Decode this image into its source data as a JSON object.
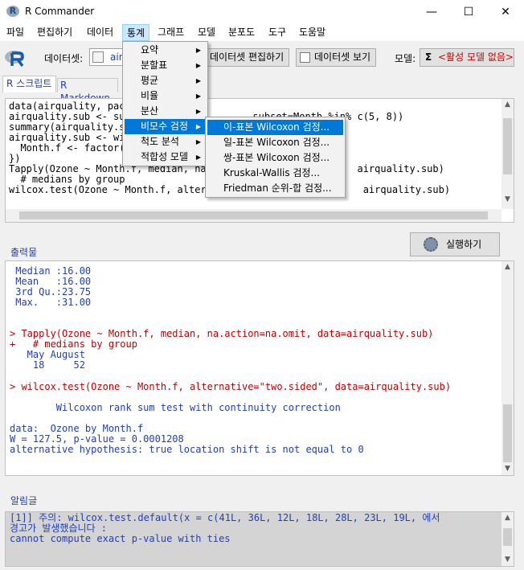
{
  "window": {
    "title": "R Commander",
    "minimize": "—",
    "maximize": "☐",
    "close": "✕"
  },
  "menubar": [
    "파일",
    "편집하기",
    "데이터",
    "통계",
    "그래프",
    "모델",
    "분포도",
    "도구",
    "도움말"
  ],
  "toolbar": {
    "dataset_label": "데이터셋:",
    "dataset_value": "air",
    "edit_dataset": "데이터셋 편집하기",
    "view_dataset": "데이터셋 보기",
    "model_label": "모델:",
    "model_sigma": "Σ",
    "model_value": "<활성 모델 없음>"
  },
  "tabs": {
    "script": "R 스크립트",
    "markdown": "R Markdown"
  },
  "script": {
    "text": "data(airquality, pac\nairquality.sub <- su                      subset=Month %in% c(5, 8))\nsummary(airquality.s\nairquality.sub <- wi\n  Month.f <- factor(\n})\nTapply(Ozone ~ Month.f, median, na.                         airquality.sub)\n  # medians by group\nwilcox.test(Ozone ~ Month.f, altern                          airquality.sub)"
  },
  "output": {
    "label": "출력물",
    "run_button": "실행하기",
    "block1": " Median :16.00\n Mean   :16.00\n 3rd Qu.:23.75\n Max.   :31.00",
    "cmd1": "> Tapply(Ozone ~ Month.f, median, na.action=na.omit, data=airquality.sub)\n+   # medians by group",
    "result1": "   May August\n    18     52",
    "cmd2": "> wilcox.test(Ozone ~ Month.f, alternative=\"two.sided\", data=airquality.sub)",
    "title": "        Wilcoxon rank sum test with continuity correction",
    "result2": "data:  Ozone by Month.f\nW = 127.5, p-value = 0.0001208\nalternative hypothesis: true location shift is not equal to 0"
  },
  "messages": {
    "label": "알림글",
    "text": "[1]] 주의: wilcox.test.default(x = c(41L, 36L, 12L, 18L, 28L, 23L, 19L, 에서\n경고가 발생했습니다 :\ncannot compute exact p-value with ties"
  },
  "stats_menu": [
    {
      "label": "요약",
      "submenu": true
    },
    {
      "label": "분할표",
      "submenu": true
    },
    {
      "label": "평균",
      "submenu": true
    },
    {
      "label": "비율",
      "submenu": true
    },
    {
      "label": "분산",
      "submenu": true
    },
    {
      "label": "비모수 검정",
      "submenu": true,
      "highlighted": true
    },
    {
      "label": "척도 분석",
      "submenu": true
    },
    {
      "label": "적합성 모델",
      "submenu": true
    }
  ],
  "nonparam_menu": [
    {
      "label": "이-표본 Wilcoxon 검정...",
      "highlighted": true
    },
    {
      "label": "일-표본 Wilcoxon 검정..."
    },
    {
      "label": "쌍-표본 Wilcoxon 검정..."
    },
    {
      "label": "Kruskal-Wallis 검정..."
    },
    {
      "label": "Friedman 순위-합 검정..."
    }
  ],
  "colors": {
    "highlight": "#0078d7",
    "command_red": "#c00000",
    "output_blue": "#1f3fbf",
    "model_red": "#d00000"
  }
}
